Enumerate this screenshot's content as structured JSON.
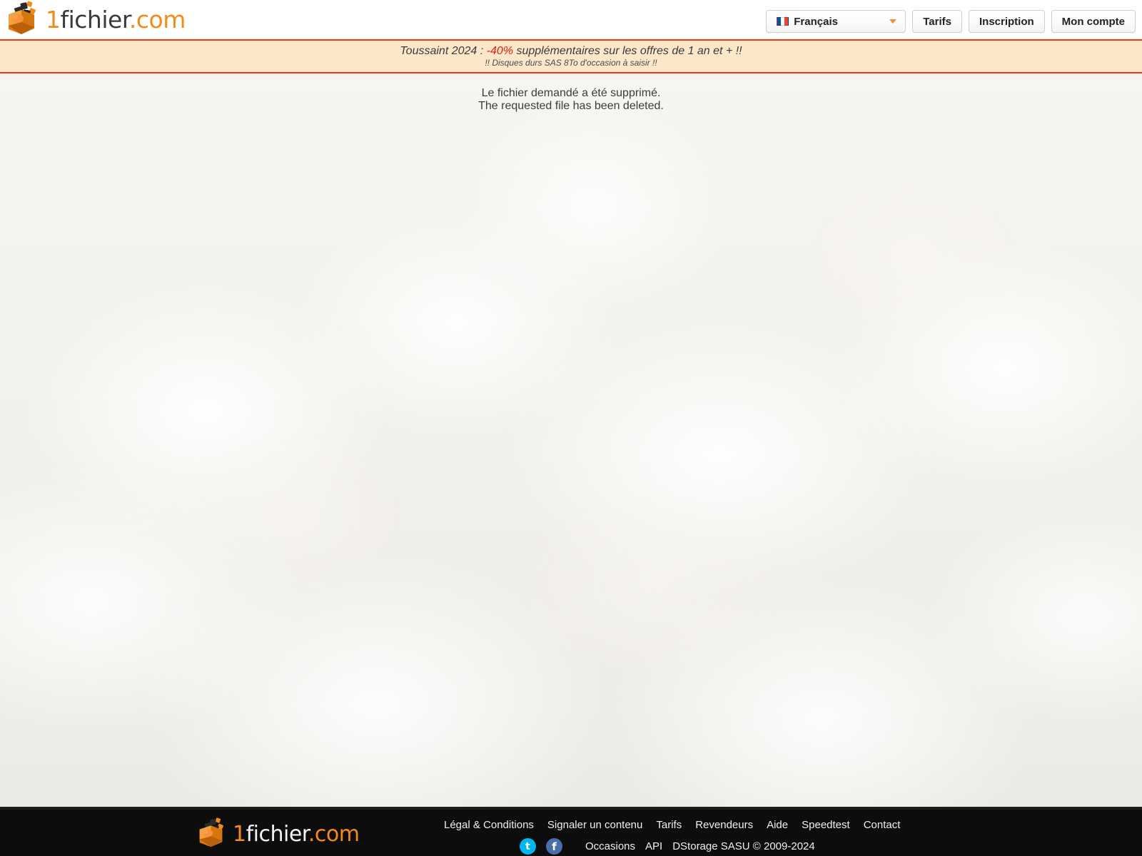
{
  "header": {
    "logo": {
      "icon": "box-logo-icon",
      "text_1": "1",
      "text_fichier": "fichier",
      "text_dot": ".",
      "text_com": "com"
    },
    "language_select": {
      "flag": "flag-france-icon",
      "label": "Français",
      "chevron": "chevron-down-icon"
    },
    "buttons": [
      {
        "label": "Tarifs"
      },
      {
        "label": "Inscription"
      },
      {
        "label": "Mon compte"
      }
    ]
  },
  "promo": {
    "line1_prefix": "Toussaint 2024 : ",
    "line1_percent": "-40%",
    "line1_suffix": " supplémentaires sur les offres de 1 an et + !!",
    "line2": "!! Disques durs SAS 8To d'occasion à saisir !!",
    "border_color": "#ef3b12",
    "background_color": "#fce7c9",
    "percent_color": "#e01b10"
  },
  "main": {
    "message_fr": "Le fichier demandé a été supprimé.",
    "message_en": "The requested file has been deleted."
  },
  "footer": {
    "logo": {
      "icon": "box-logo-icon",
      "text_1": "1",
      "text_fichier": "fichier",
      "text_dot": ".",
      "text_com": "com"
    },
    "links_row1": [
      {
        "label": "Légal & Conditions"
      },
      {
        "label": "Signaler un contenu"
      },
      {
        "label": "Tarifs"
      },
      {
        "label": "Revendeurs"
      },
      {
        "label": "Aide"
      },
      {
        "label": "Speedtest"
      },
      {
        "label": "Contact"
      }
    ],
    "social": [
      {
        "name": "twitter",
        "glyph": "t",
        "color": "#00b6f0"
      },
      {
        "name": "facebook",
        "glyph": "f",
        "color": "#4a6ea9"
      }
    ],
    "links_row2": [
      {
        "label": "Occasions"
      },
      {
        "label": "API"
      }
    ],
    "copyright": "DStorage SASU © 2009-2024",
    "background_color": "#0d0d0d"
  },
  "theme": {
    "brand_orange": "#f28c18",
    "page_background": "#f6f4f0"
  }
}
